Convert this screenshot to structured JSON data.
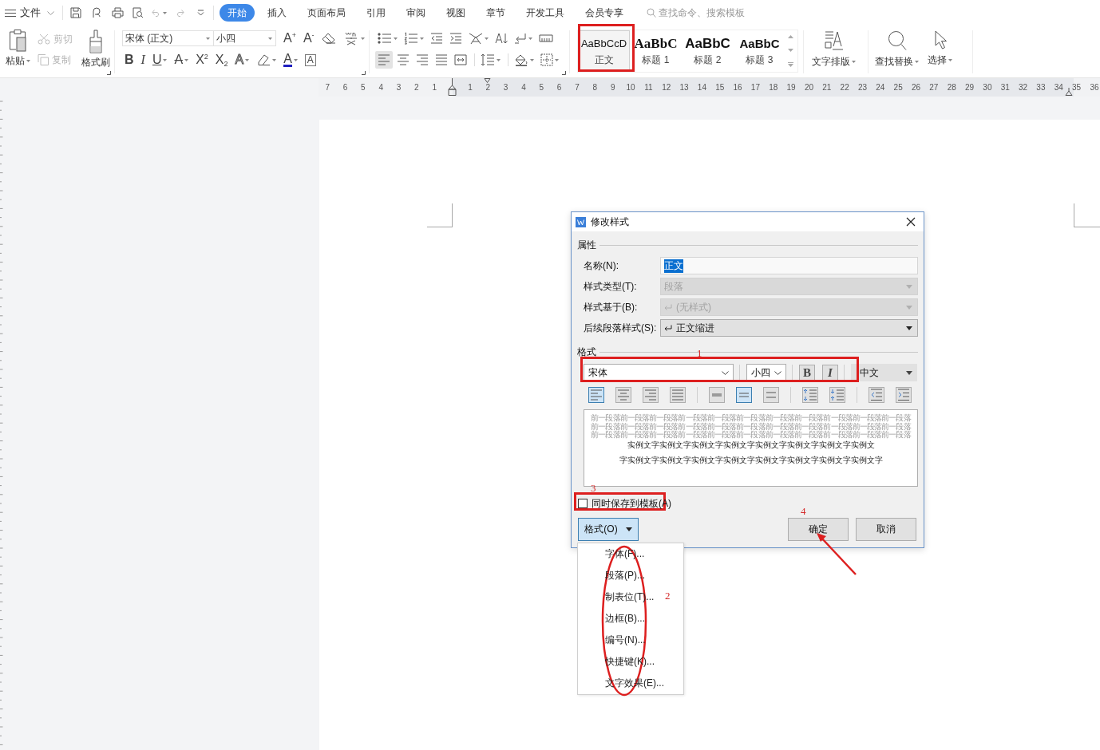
{
  "menu_bar": {
    "file_menu": "文件",
    "quick_access": [
      {
        "kind": "save",
        "disabled": false,
        "dropdown": false
      },
      {
        "kind": "export",
        "disabled": false,
        "dropdown": false
      },
      {
        "kind": "print",
        "disabled": false,
        "dropdown": false
      },
      {
        "kind": "preview",
        "disabled": false,
        "dropdown": false
      },
      {
        "kind": "undo",
        "disabled": true,
        "dropdown": true
      },
      {
        "kind": "redo",
        "disabled": true,
        "dropdown": false
      },
      {
        "kind": "customize",
        "disabled": false,
        "dropdown": false
      }
    ],
    "tabs": [
      {
        "label": "开始",
        "selected": true
      },
      {
        "label": "插入",
        "selected": false
      },
      {
        "label": "页面布局",
        "selected": false
      },
      {
        "label": "引用",
        "selected": false
      },
      {
        "label": "审阅",
        "selected": false
      },
      {
        "label": "视图",
        "selected": false
      },
      {
        "label": "章节",
        "selected": false
      },
      {
        "label": "开发工具",
        "selected": false
      },
      {
        "label": "会员专享",
        "selected": false
      }
    ],
    "search": {
      "placeholder": "查找命令、搜索模板"
    }
  },
  "ribbon": {
    "clipboard": [
      {
        "kind": "paste",
        "label": "粘贴",
        "disabled": false,
        "dropdown": true
      },
      {
        "kind": "cut",
        "label": "剪切",
        "disabled": true,
        "dropdown": false
      },
      {
        "kind": "copy",
        "label": "复制",
        "disabled": true,
        "dropdown": false
      },
      {
        "kind": "painter",
        "label": "格式刷",
        "disabled": false,
        "dropdown": false
      }
    ],
    "font": {
      "name": "宋体 (正文)",
      "size": "小四",
      "row_1": [
        {
          "kind": "grow",
          "glyph": "A$^{+}$",
          "dropdown": false
        },
        {
          "kind": "shrink",
          "glyph": "A$^{-}$",
          "dropdown": false
        },
        {
          "kind": "clear",
          "dropdown": false
        },
        {
          "kind": "phonetic",
          "dropdown": true
        }
      ],
      "row_2": [
        {
          "kind": "bold",
          "glyph": "B",
          "dropdown": false
        },
        {
          "kind": "italic",
          "glyph": "I",
          "dropdown": false
        },
        {
          "kind": "underline",
          "glyph": "U",
          "dropdown": true
        },
        {
          "kind": "strike",
          "glyph": "A",
          "dropdown": true
        },
        {
          "kind": "superscript",
          "glyph": "X$^{2}$",
          "dropdown": false
        },
        {
          "kind": "subscript",
          "glyph": "X$_{2}$",
          "dropdown": false
        },
        {
          "kind": "effects",
          "glyph": "A",
          "dropdown": true
        },
        {
          "kind": "highlight",
          "dropdown": true
        },
        {
          "kind": "color",
          "glyph": "A",
          "dropdown": true
        },
        {
          "kind": "char_border",
          "glyph": "A",
          "dropdown": false
        }
      ]
    },
    "paragraph": {
      "row_1": [
        {
          "kind": "bullets",
          "dropdown": true
        },
        {
          "kind": "numbering",
          "dropdown": true
        },
        {
          "kind": "outdent",
          "dropdown": false
        },
        {
          "kind": "indent",
          "dropdown": false
        },
        {
          "kind": "cn_layout",
          "dropdown": true
        },
        {
          "kind": "sort",
          "dropdown": false
        },
        {
          "kind": "marks",
          "dropdown": true
        },
        {
          "kind": "table_ruler",
          "dropdown": false
        }
      ],
      "row_2": [
        {
          "kind": "align_left",
          "selected": true,
          "dropdown": false
        },
        {
          "kind": "align_center",
          "selected": false,
          "dropdown": false
        },
        {
          "kind": "align_right",
          "selected": false,
          "dropdown": false
        },
        {
          "kind": "justify",
          "selected": false,
          "dropdown": false
        },
        {
          "kind": "distribute",
          "selected": false,
          "dropdown": false
        },
        {
          "kind": "line_spacing",
          "selected": false,
          "dropdown": true
        },
        {
          "kind": "shading",
          "selected": false,
          "dropdown": true
        },
        {
          "kind": "borders",
          "selected": false,
          "dropdown": true
        }
      ]
    },
    "styles": [
      {
        "kind": "body",
        "preview": "AaBbCcD",
        "label": "正文",
        "selected": true
      },
      {
        "kind": "heading_1",
        "preview": "AaBbC",
        "label": "标题 1",
        "selected": false
      },
      {
        "kind": "heading_2",
        "preview": "AaBbC",
        "label": "标题 2",
        "selected": false
      },
      {
        "kind": "heading_3",
        "preview": "AaBbC",
        "label": "标题 3",
        "selected": false
      }
    ],
    "tools": [
      {
        "kind": "typesetting",
        "label": "文字排版",
        "dropdown": true
      },
      {
        "kind": "find",
        "label": "查找替换",
        "dropdown": true
      },
      {
        "kind": "select",
        "label": "选择",
        "dropdown": true
      }
    ]
  },
  "ruler": {
    "left_numbers": [
      "7",
      "6",
      "5",
      "4",
      "3",
      "2",
      "1"
    ],
    "right_numbers": [
      "1",
      "2",
      "3",
      "4",
      "5",
      "6",
      "7",
      "8",
      "9",
      "10",
      "11",
      "12",
      "13",
      "14",
      "15",
      "16",
      "17",
      "18",
      "19",
      "20",
      "21",
      "22",
      "23",
      "24",
      "25",
      "26",
      "27",
      "28",
      "29",
      "30",
      "31",
      "32",
      "33",
      "34",
      "35",
      "36"
    ]
  },
  "dialog": {
    "title": "修改样式",
    "properties": {
      "heading": "属性",
      "fields": [
        {
          "label": "名称(N):",
          "kind": "text",
          "value": "正文",
          "disabled": false,
          "highlighted": true
        },
        {
          "label": "样式类型(T):",
          "kind": "select",
          "value": "段落",
          "disabled": true,
          "highlighted": false
        },
        {
          "label": "样式基于(B):",
          "kind": "style_select",
          "value": "(无样式)",
          "disabled": true,
          "highlighted": false
        },
        {
          "label": "后续段落样式(S):",
          "kind": "style_select",
          "value": "正文缩进",
          "disabled": false,
          "highlighted": false
        }
      ]
    },
    "format": {
      "heading": "格式",
      "font": "宋体",
      "size": "小四",
      "bold": "B",
      "italic": "I",
      "language": "中文",
      "paragraph_buttons": [
        {
          "kind": "align_left",
          "selected": true
        },
        {
          "kind": "align_center",
          "selected": false
        },
        {
          "kind": "align_right",
          "selected": false
        },
        {
          "kind": "justify",
          "selected": false
        },
        {
          "kind": "single_spacing",
          "selected": false
        },
        {
          "kind": "one_half_spacing",
          "selected": true
        },
        {
          "kind": "double_spacing",
          "selected": false
        },
        {
          "kind": "space_before_more",
          "selected": false
        },
        {
          "kind": "space_before_less",
          "selected": false
        },
        {
          "kind": "indent_less",
          "selected": false
        },
        {
          "kind": "indent_more",
          "selected": false
        }
      ]
    },
    "preview": {
      "previous_lines": [
        "前一段落前一段落前一段落前一段落前一段落前一段落前一段落前一段落前一段落前一段落前一段落",
        "前一段落前一段落前一段落前一段落前一段落前一段落前一段落前一段落前一段落前一段落前一段落",
        "前一段落前一段落前一段落前一段落前一段落前一段落前一段落前一段落前一段落前一段落前一段落"
      ],
      "sample_lines": [
        "实例文字实例文字实例文字实例文字实例文字实例文字实例文字实例文",
        "字实例文字实例文字实例文字实例文字实例文字实例文字实例文字实例文字"
      ]
    },
    "save_to_template": {
      "label": "同时保存到模板(A)",
      "checked": false
    },
    "format_button": {
      "label": "格式(O)",
      "expanded": true
    },
    "buttons": [
      "确定",
      "取消"
    ]
  },
  "format_menu": {
    "items": [
      "字体(F)...",
      "段落(P)...",
      "制表位(T)...",
      "边框(B)...",
      "编号(N)...",
      "快捷键(K)...",
      "文字效果(E)..."
    ]
  },
  "annotations": {
    "numbers": [
      "1",
      "2",
      "3",
      "4"
    ]
  }
}
